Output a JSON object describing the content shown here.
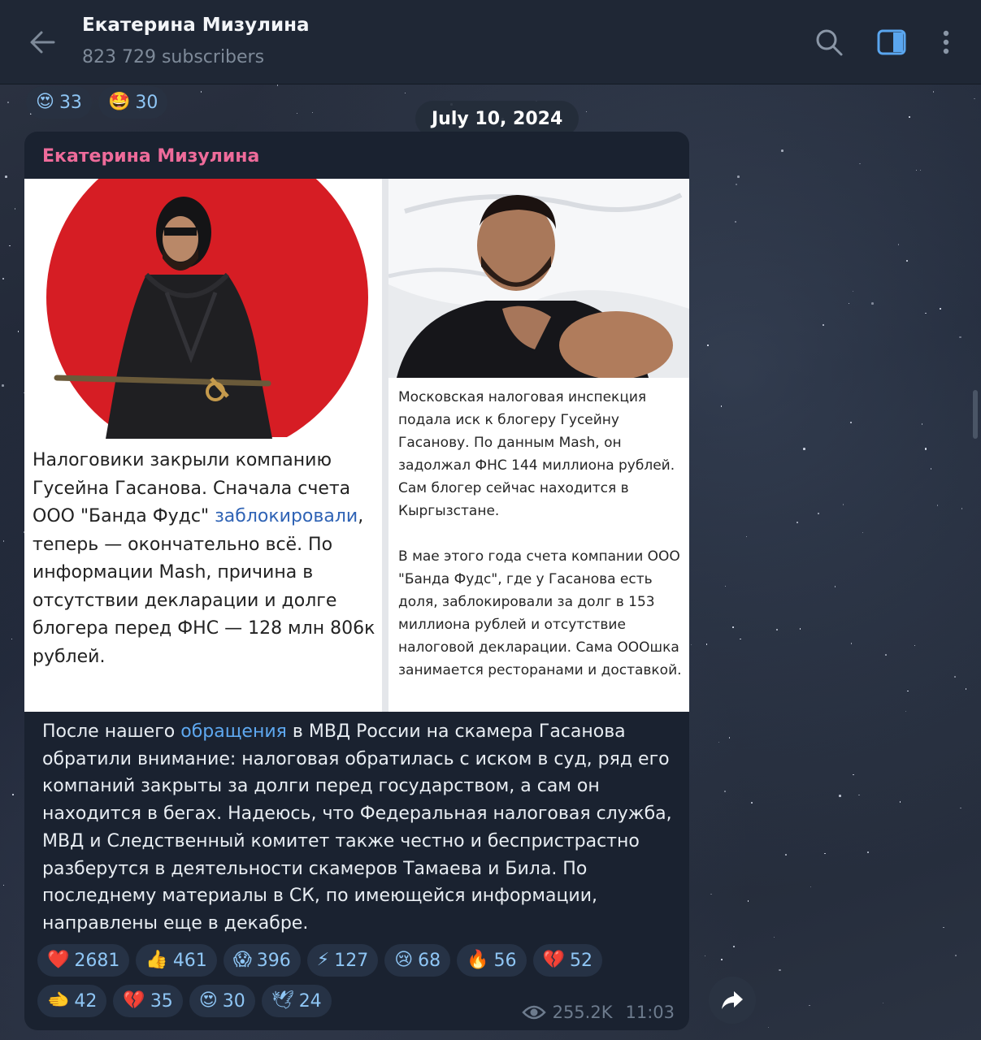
{
  "header": {
    "title": "Екатерина Мизулина",
    "subtitle": "823 729 subscribers",
    "icons": [
      "back-arrow-icon",
      "search-icon",
      "sidebar-toggle-icon",
      "more-vertical-icon"
    ]
  },
  "prev_message": {
    "reactions": [
      {
        "emoji": "😍",
        "count": "33"
      },
      {
        "emoji": "🤩",
        "count": "30"
      }
    ]
  },
  "date_divider": "July 10, 2024",
  "message": {
    "author": "Екатерина Мизулина",
    "media_left": {
      "text_before_link": "Налоговики закрыли компанию Гусейна Гасанова. Сначала счета ООО \"Банда Фудс\" ",
      "link": "заблокировали",
      "text_after_link": ", теперь — окончательно всё. По информации Mash, причина в отсутствии декларации и долге блогера перед ФНС — 128 млн 806к рублей."
    },
    "media_right": {
      "paragraph1": "Московская налоговая инспекция подала иск к блогеру Гусейну Гасанову. По данным Mash, он задолжал ФНС 144 миллиона рублей. Сам блогер сейчас находится в Кыргызстане.",
      "paragraph2": "В мае этого года счета компании ООО \"Банда Фудс\", где у Гасанова есть доля, заблокировали за долг в 153 миллиона рублей и отсутствие налоговой декларации. Сама ОООшка занимается ресторанами и доставкой."
    },
    "text_before_link": "После нашего ",
    "link": "обращения",
    "text_after_link": " в МВД России на скамера Гасанова обратили внимание: налоговая обратилась с иском в суд, ряд его компаний закрыты за долги перед государством, а сам он находится в бегах. Надеюсь, что Федеральная налоговая служба, МВД и Следственный комитет также честно и беспристрастно разберутся в деятельности скамеров Тамаева и Била. По последнему материалы в СК, по имеющейся информации, направлены еще в декабре.",
    "reactions_row1": [
      {
        "emoji": "❤️",
        "count": "2681"
      },
      {
        "emoji": "👍",
        "count": "461"
      },
      {
        "emoji": "😱",
        "count": "396"
      },
      {
        "emoji": "⚡",
        "count": "127"
      },
      {
        "emoji": "😢",
        "count": "68"
      },
      {
        "emoji": "🔥",
        "count": "56"
      },
      {
        "emoji": "💔",
        "count": "52"
      }
    ],
    "reactions_row2": [
      {
        "emoji": "🫲",
        "count": "42"
      },
      {
        "emoji": "💔",
        "count": "35"
      },
      {
        "emoji": "😍",
        "count": "30"
      },
      {
        "emoji": "🕊",
        "count": "24"
      }
    ],
    "views": "255.2K",
    "time": "11:03"
  },
  "colors": {
    "author": "#ee6b9a",
    "link": "#5ea8f0",
    "reaction_count": "#8fc6f5",
    "bubble": "#1a2230"
  }
}
